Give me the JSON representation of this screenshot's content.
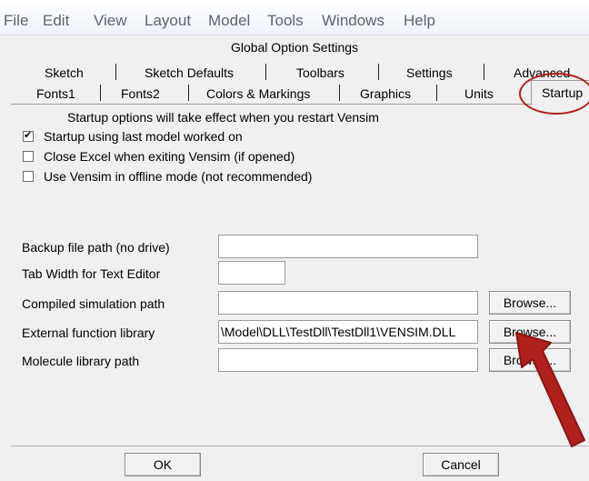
{
  "menubar": {
    "items": [
      "File",
      "Edit",
      "View",
      "Layout",
      "Model",
      "Tools",
      "Windows",
      "Help"
    ]
  },
  "dialog": {
    "title": "Global Option Settings",
    "tabs_row1": [
      "Sketch",
      "Sketch Defaults",
      "Toolbars",
      "Settings",
      "Advanced"
    ],
    "tabs_row2": [
      "Fonts1",
      "Fonts2",
      "Colors & Markings",
      "Graphics",
      "Units",
      "Startup"
    ],
    "active_tab": "Startup",
    "startup_note": "Startup options will take effect when you restart Vensim",
    "checkboxes": [
      {
        "label": "Startup using last model worked on",
        "checked": true
      },
      {
        "label": "Close Excel when exiting Vensim (if opened)",
        "checked": false
      },
      {
        "label": "Use Vensim in offline mode (not recommended)",
        "checked": false
      }
    ],
    "fields": {
      "backup": {
        "label": "Backup file path (no drive)",
        "value": ""
      },
      "tabwidth": {
        "label": "Tab Width for Text Editor",
        "value": ""
      },
      "compiled": {
        "label": "Compiled simulation path",
        "value": "",
        "button": "Browse..."
      },
      "external": {
        "label": "External function library",
        "value": "\\Model\\DLL\\TestDll\\TestDll1\\VENSIM.DLL",
        "button": "Browse..."
      },
      "molecule": {
        "label": "Molecule library path",
        "value": "",
        "button": "Browse..."
      }
    },
    "ok_label": "OK",
    "cancel_label": "Cancel"
  },
  "colors": {
    "annotation": "#b0201c",
    "window_bg": "#f0f0f0",
    "menu_text": "#5c6270"
  }
}
